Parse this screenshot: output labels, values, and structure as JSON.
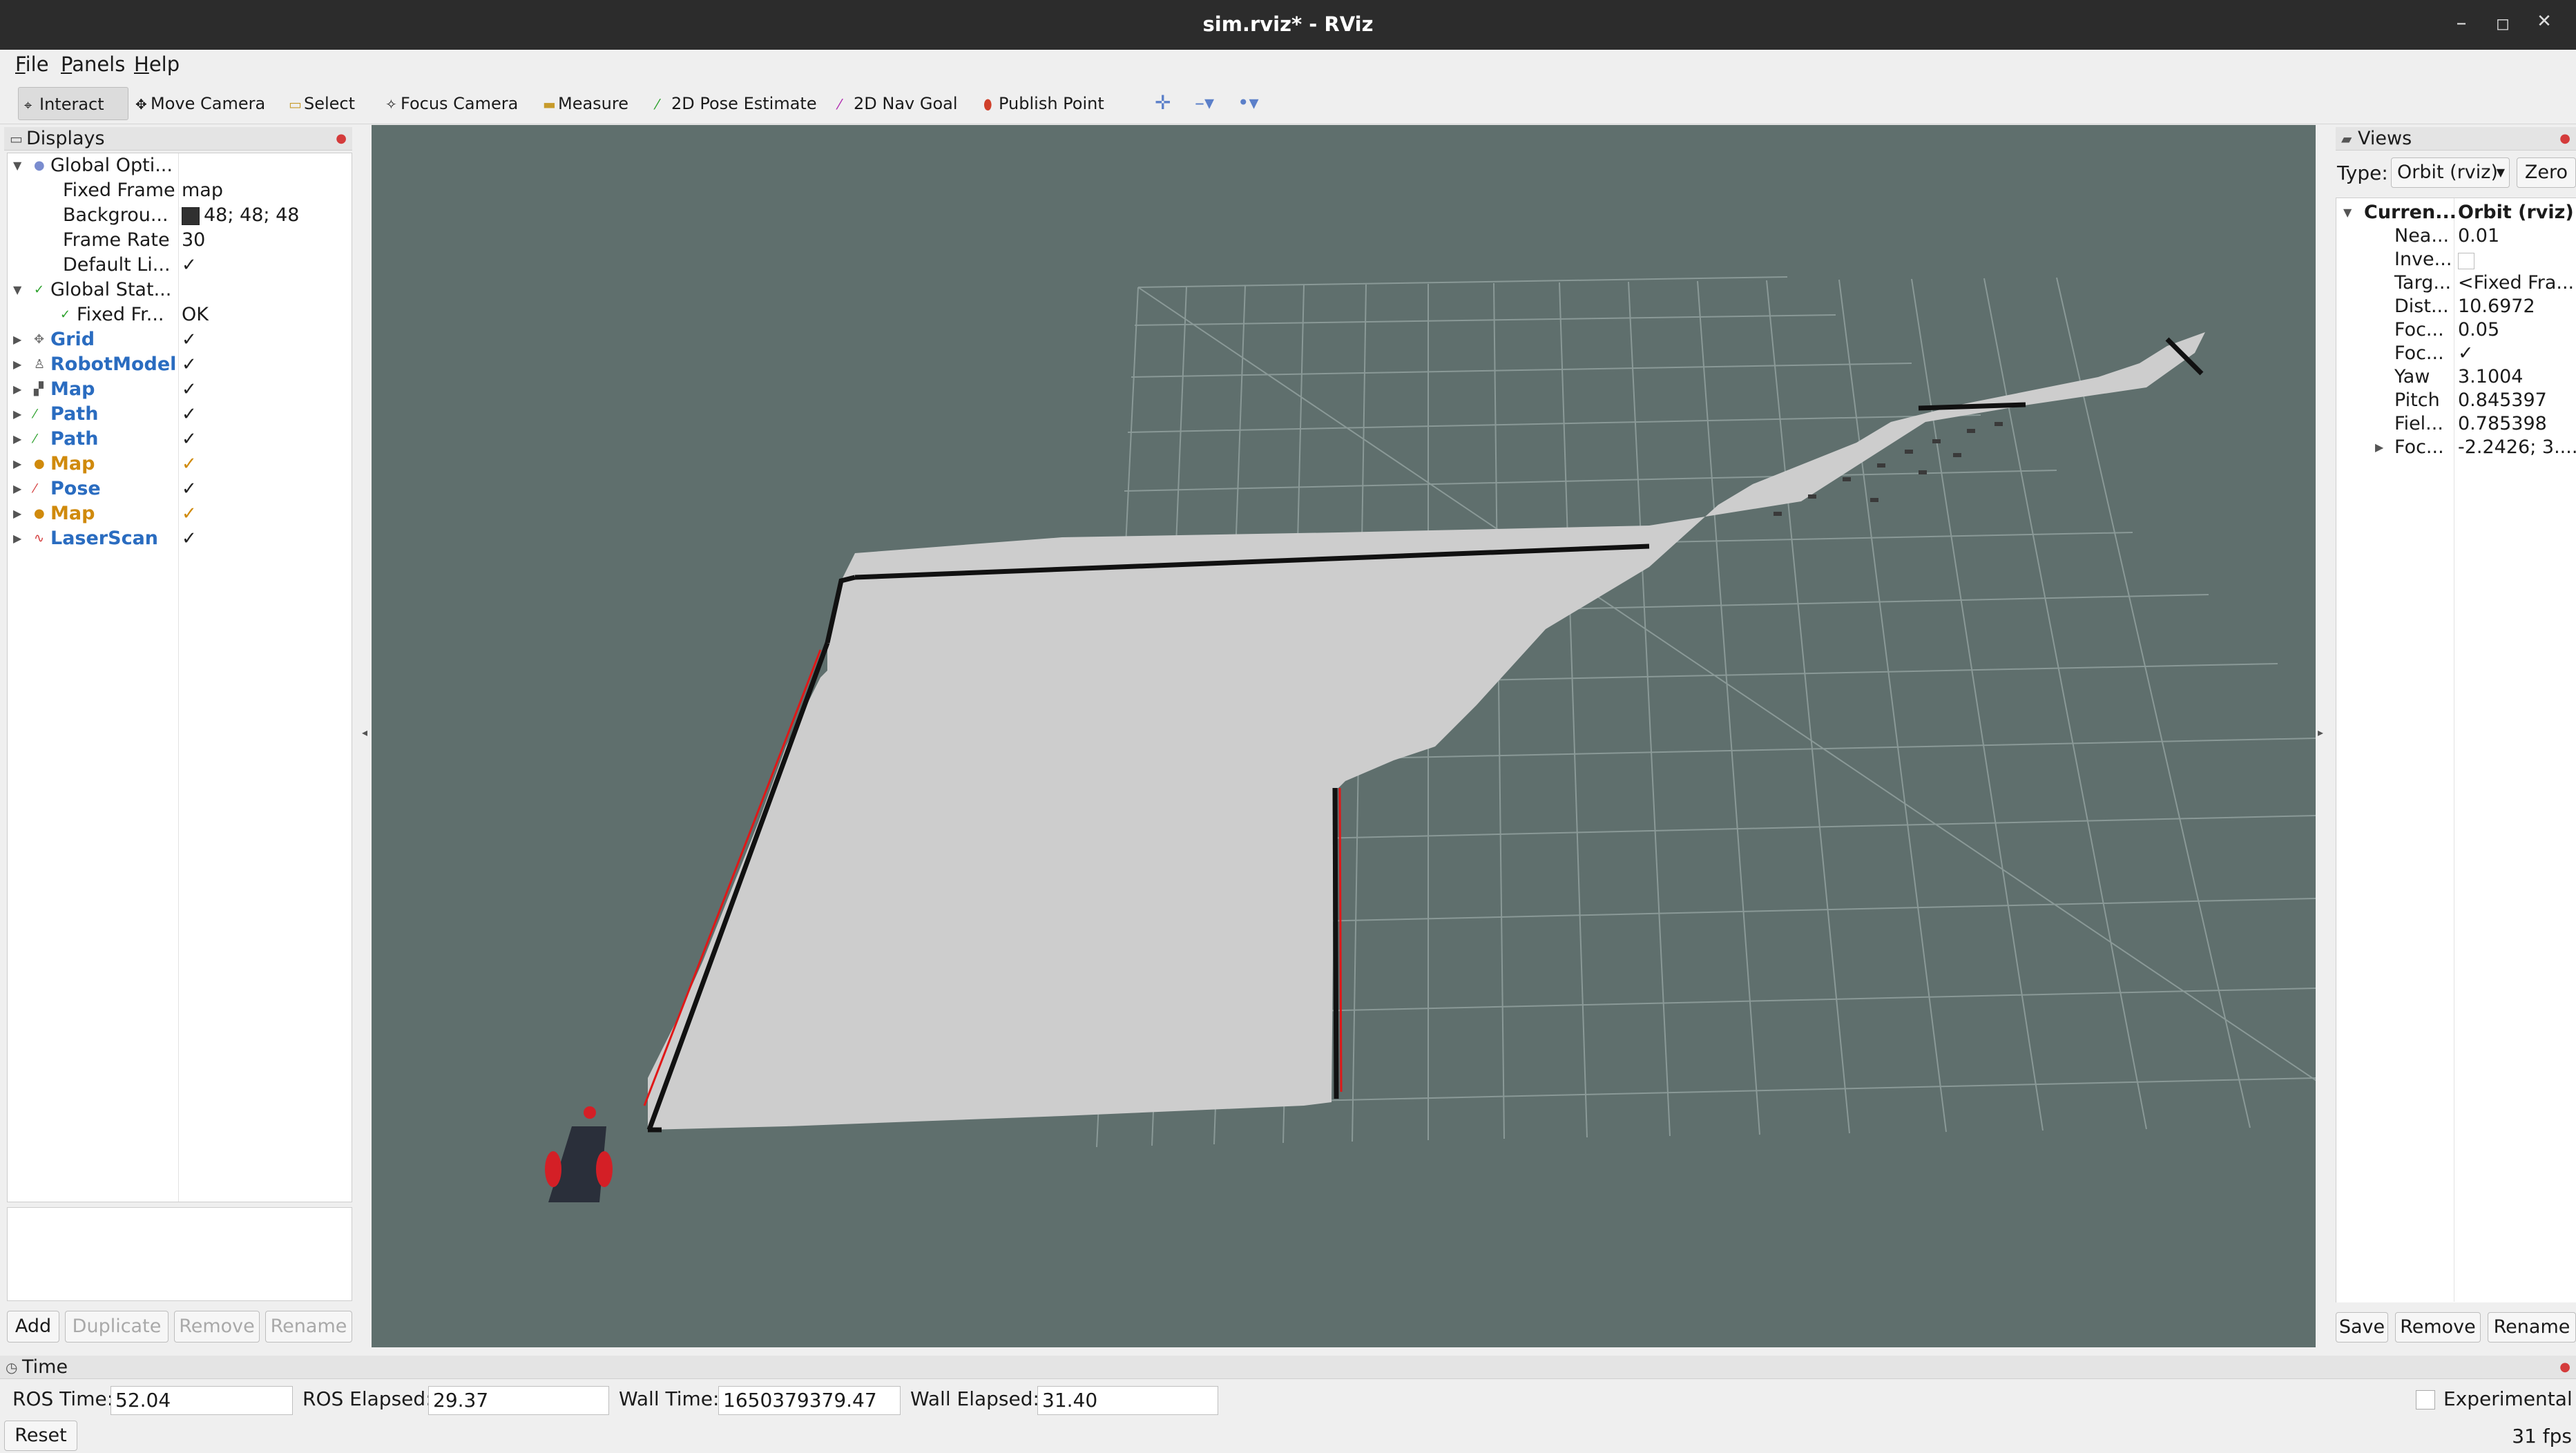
{
  "window": {
    "title": "sim.rviz* - RViz",
    "minimize": "–",
    "maximize": "◻",
    "close": "✕"
  },
  "menu": [
    "File",
    "Panels",
    "Help"
  ],
  "toolbar": {
    "tools": [
      "Interact",
      "Move Camera",
      "Select",
      "Focus Camera",
      "Measure",
      "2D Pose Estimate",
      "2D Nav Goal",
      "Publish Point"
    ],
    "active": "Interact"
  },
  "displays": {
    "title": "Displays",
    "rows": [
      {
        "name": "Global Opti...",
        "value": ""
      },
      {
        "name": "Fixed Frame",
        "value": "map"
      },
      {
        "name": "Backgrou...",
        "value": "48; 48; 48"
      },
      {
        "name": "Frame Rate",
        "value": "30"
      },
      {
        "name": "Default Li...",
        "value": "✓"
      },
      {
        "name": "Global Stat...",
        "value": ""
      },
      {
        "name": "Fixed Fr...",
        "value": "OK"
      },
      {
        "name": "Grid",
        "value": "✓"
      },
      {
        "name": "RobotModel",
        "value": "✓"
      },
      {
        "name": "Map",
        "value": "✓"
      },
      {
        "name": "Path",
        "value": "✓"
      },
      {
        "name": "Path",
        "value": "✓"
      },
      {
        "name": "Map",
        "value": "✓"
      },
      {
        "name": "Pose",
        "value": "✓"
      },
      {
        "name": "Map",
        "value": "✓"
      },
      {
        "name": "LaserScan",
        "value": "✓"
      }
    ],
    "buttons": {
      "add": "Add",
      "duplicate": "Duplicate",
      "remove": "Remove",
      "rename": "Rename"
    }
  },
  "views": {
    "title": "Views",
    "type_label": "Type:",
    "type_value": "Orbit (rviz)",
    "zero_label": "Zero",
    "rows": [
      {
        "name": "Curren...",
        "value": "Orbit (rviz)"
      },
      {
        "name": "Nea...",
        "value": "0.01"
      },
      {
        "name": "Inve...",
        "value": ""
      },
      {
        "name": "Targ...",
        "value": "<Fixed Fra..."
      },
      {
        "name": "Dist...",
        "value": "10.6972"
      },
      {
        "name": "Foc...",
        "value": "0.05"
      },
      {
        "name": "Foc...",
        "value": "✓"
      },
      {
        "name": "Yaw",
        "value": "3.1004"
      },
      {
        "name": "Pitch",
        "value": "0.845397"
      },
      {
        "name": "Fiel...",
        "value": "0.785398"
      },
      {
        "name": "Foc...",
        "value": "-2.2426; 3...."
      }
    ],
    "buttons": {
      "save": "Save",
      "remove": "Remove",
      "rename": "Rename"
    }
  },
  "time": {
    "title": "Time",
    "ros_time_label": "ROS Time:",
    "ros_time": "52.04",
    "ros_elapsed_label": "ROS Elapsed:",
    "ros_elapsed": "29.37",
    "wall_time_label": "Wall Time:",
    "wall_time": "1650379379.47",
    "wall_elapsed_label": "Wall Elapsed:",
    "wall_elapsed": "31.40",
    "experimental_label": "Experimental",
    "reset_label": "Reset",
    "fps": "31 fps"
  },
  "colors": {
    "viewport_bg": "#5f6f6d",
    "map_free": "#cdcdcd",
    "wall": "#111111",
    "laser": "#e01818",
    "grid": "#8a9997",
    "robot_body": "#2a2f3a",
    "robot_wheel": "#d41f26",
    "accent_blue": "#2a6cc0",
    "accent_orange": "#d08a0c"
  }
}
